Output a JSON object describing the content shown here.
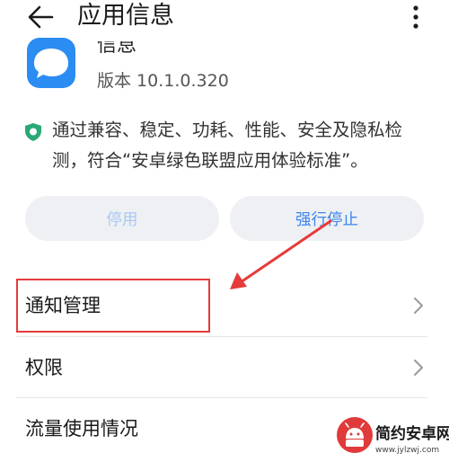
{
  "header": {
    "title": "应用信息",
    "back_icon": "arrow-left-icon",
    "more_icon": "more-vertical-icon"
  },
  "app": {
    "name_partial": "信息",
    "version": "版本 10.1.0.320",
    "icon": "message-app-icon",
    "icon_color": "#2b8cf2"
  },
  "certification": {
    "icon": "shield-check-icon",
    "text": "通过兼容、稳定、功耗、性能、安全及隐私检测，符合“安卓绿色联盟应用体验标准”。"
  },
  "buttons": {
    "disable_label": "停用",
    "force_stop_label": "强行停止"
  },
  "list": {
    "items": [
      {
        "label": "通知管理"
      },
      {
        "label": "权限"
      },
      {
        "label": "流量使用情况"
      }
    ]
  },
  "watermark": {
    "title": "简约安卓网",
    "url": "www.jylzwj.com"
  },
  "colors": {
    "accent": "#3d86f0",
    "highlight": "#e53b3b",
    "button_bg": "#eef0f3"
  }
}
